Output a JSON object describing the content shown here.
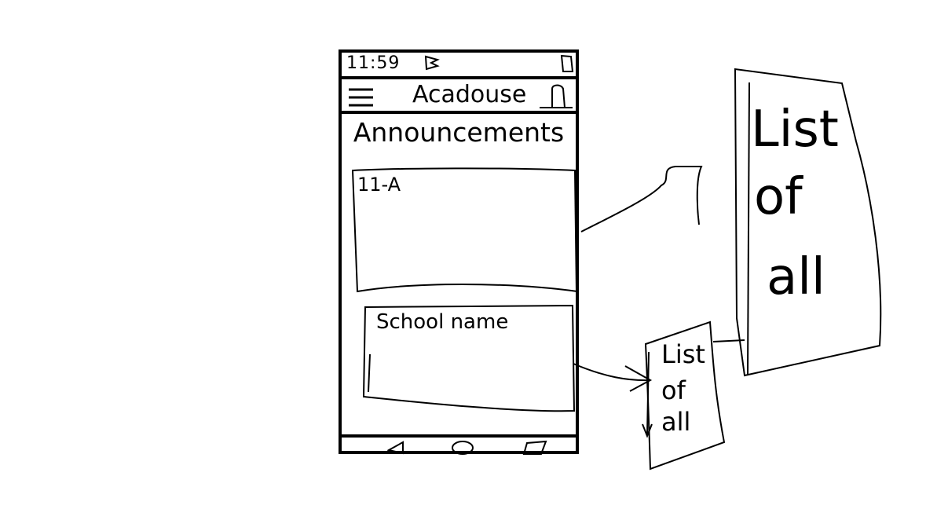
{
  "status_bar": {
    "time": "11:59",
    "app_icon": "app-b-icon",
    "battery_icon": "battery-icon"
  },
  "app_bar": {
    "title": "Acadouse",
    "menu_icon": "hamburger-menu-icon",
    "profile_icon": "profile-icon"
  },
  "page": {
    "title": "Announcements"
  },
  "cards": [
    {
      "label": "11-A"
    },
    {
      "label": "School name"
    }
  ],
  "nav_bar": {
    "back_icon": "back-triangle-icon",
    "home_icon": "home-circle-icon",
    "recent_icon": "recents-square-icon"
  },
  "big_list": {
    "line1": "List",
    "line2": "of",
    "line3": "all"
  },
  "small_list": {
    "line1": "List",
    "line2": "of",
    "line3": "all"
  }
}
